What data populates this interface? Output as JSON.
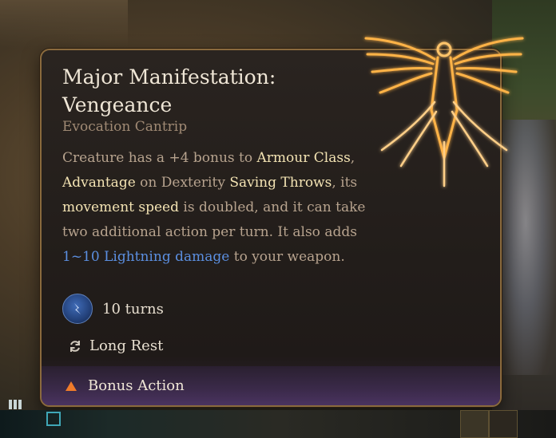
{
  "tooltip": {
    "title_line1": "Major Manifestation:",
    "title_line2": "Vengeance",
    "subtitle": "Evocation Cantrip",
    "description": [
      {
        "text": "Creature has a +4 bonus to ",
        "style": "plain"
      },
      {
        "text": "Armour Class",
        "style": "keyword"
      },
      {
        "text": ", ",
        "style": "plain"
      },
      {
        "text": "Advantage",
        "style": "keyword"
      },
      {
        "text": " on Dexterity ",
        "style": "plain"
      },
      {
        "text": "Saving Throws",
        "style": "keyword"
      },
      {
        "text": ", its ",
        "style": "plain"
      },
      {
        "text": "movement speed",
        "style": "keyword"
      },
      {
        "text": " is doubled, and it can take two additional action per turn. It also adds ",
        "style": "plain"
      },
      {
        "text": "1~10 Lightning damage",
        "style": "damage"
      },
      {
        "text": " to your weapon.",
        "style": "plain"
      }
    ],
    "duration": {
      "icon": "lightning-duration-icon",
      "label": "10 turns"
    },
    "recharge": {
      "icon": "recharge-cycle-icon",
      "label": "Long Rest"
    },
    "action": {
      "icon": "bonus-action-triangle-icon",
      "label": "Bonus Action"
    }
  },
  "colors": {
    "title": "#efe6d6",
    "subtitle": "#a08a74",
    "body_text": "#b7a38e",
    "keyword": "#f3e3b3",
    "damage": "#5b8fe0",
    "border": "#8a6a3d",
    "action_triangle": "#ef7b2a",
    "emblem_glow": "#ffb347"
  },
  "hud": {
    "left_icon": "party-grid-icon",
    "slot_icon": "selected-slot-icon",
    "right_icons": [
      "character-portrait-icon",
      "spell-icon"
    ]
  }
}
